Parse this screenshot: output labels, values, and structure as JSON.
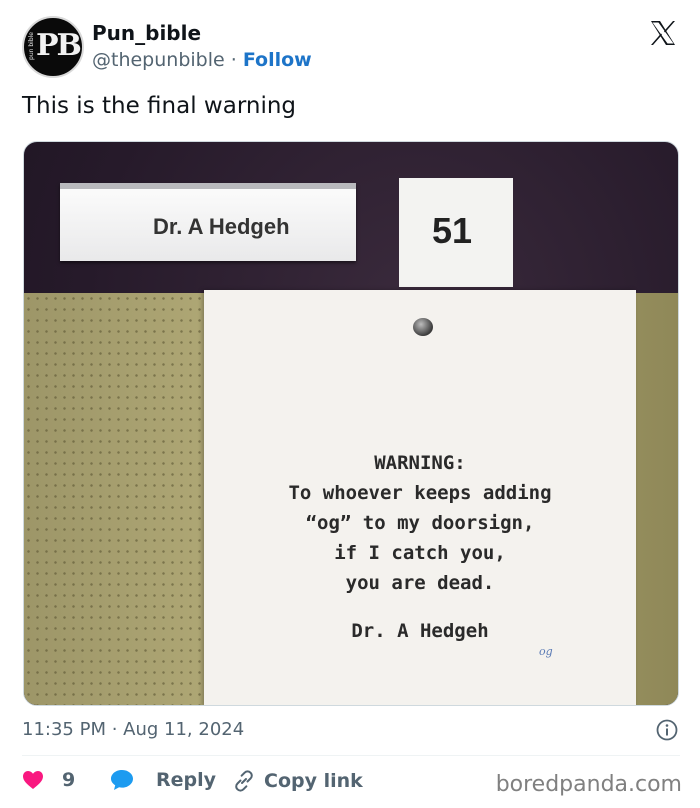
{
  "author": {
    "name": "Pun_bible",
    "handle": "@thepunbible",
    "separator": "·",
    "follow_label": "Follow",
    "avatar_initials": "PB",
    "avatar_side_text": "pun bible"
  },
  "tweet": {
    "text": "This is the final warning"
  },
  "photo": {
    "nameplate": "Dr. A Hedgeh",
    "room_number": "51",
    "note_lines": [
      "WARNING:",
      "To whoever keeps adding",
      "“og” to my doorsign,",
      "if I catch you,",
      "you are dead."
    ],
    "note_signature": "Dr. A Hedgeh",
    "scribble": "og"
  },
  "meta": {
    "timestamp": "11:35 PM · Aug 11, 2024"
  },
  "actions": {
    "like_count": "9",
    "reply_label": "Reply",
    "copy_label": "Copy link"
  },
  "watermark": "boredpanda.com",
  "colors": {
    "like": "#f91880",
    "reply": "#1d9bf0",
    "follow": "#1d74c8"
  }
}
